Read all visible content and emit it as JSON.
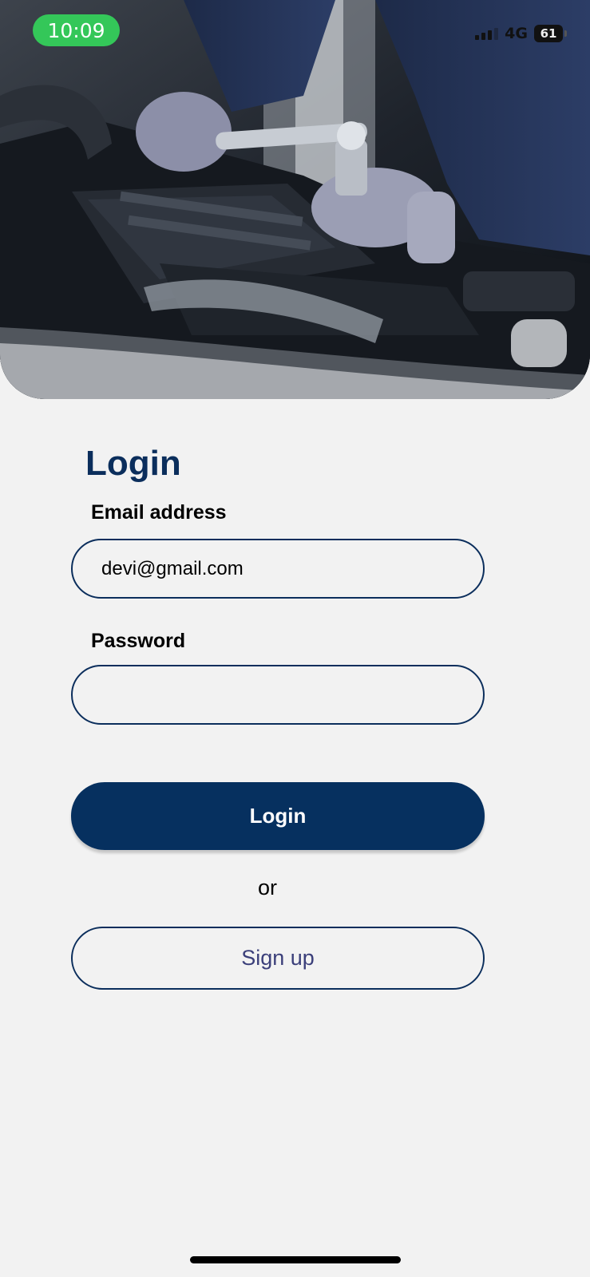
{
  "status_bar": {
    "time": "10:09",
    "network": "4G",
    "battery": "61",
    "time_pill_color": "#34c759"
  },
  "hero": {
    "image_description_icon": "mechanic-engine-photo"
  },
  "form": {
    "title": "Login",
    "email_label": "Email address",
    "email_value": "devi@gmail.com",
    "password_label": "Password",
    "password_value": "",
    "login_button": "Login",
    "or_text": "or",
    "signup_button": "Sign up"
  },
  "colors": {
    "primary": "#06305f",
    "title": "#0b2e5c",
    "background": "#f2f2f2"
  }
}
